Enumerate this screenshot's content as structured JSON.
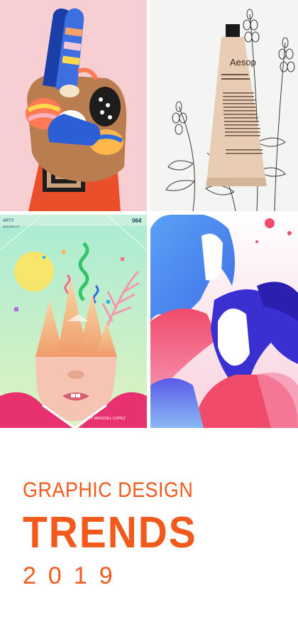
{
  "colors": {
    "accent": "#f25a1d",
    "page_background": "#ffffff"
  },
  "collage": {
    "hand_tile": {
      "icon": "crossed-fingers-illustration"
    },
    "tube_tile": {
      "icon": "cream-tube-with-lavender-sketch",
      "tube_brand": "Aesop"
    },
    "poster_tile": {
      "icon": "surreal-face-poster",
      "corner_label_left": "ARTY",
      "corner_label_left_sub": "MADDIELOP",
      "corner_label_right": "064",
      "credit": "BY MAGDIEL LOPEZ"
    },
    "women_tile": {
      "icon": "two-women-silhouettes-illustration"
    }
  },
  "title": {
    "line1": "GRAPHIC DESIGN",
    "line2": "TRENDS",
    "line3": "2019"
  }
}
